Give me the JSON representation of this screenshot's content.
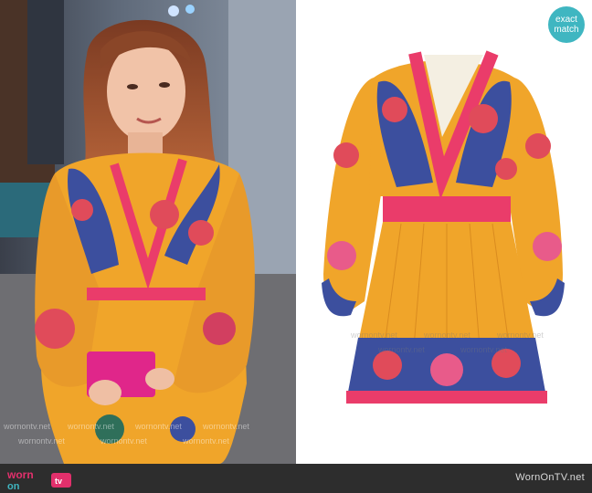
{
  "badge": {
    "line1": "exact",
    "line2": "match",
    "color": "#3fb6c1"
  },
  "footer": {
    "site": "WornOnTV.net",
    "logo_word1": "worn",
    "logo_word2": "on",
    "logo_word3": "tv"
  },
  "watermark": "wornontv.net",
  "colors": {
    "dress_yellow": "#f0a52a",
    "dress_pink": "#ea3c6a",
    "dress_blue": "#3c4f9e",
    "footer_bg": "#2d2d2d",
    "logo_pink": "#e2306c",
    "logo_teal": "#3fb6c1"
  }
}
